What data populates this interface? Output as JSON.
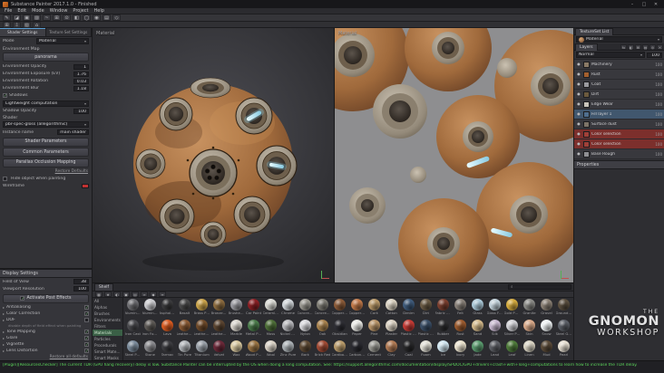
{
  "window": {
    "title": "Substance Painter 2017.1.0 - Finished",
    "controls": [
      {
        "name": "minimize-button",
        "glyph": "–"
      },
      {
        "name": "maximize-button",
        "glyph": "□"
      },
      {
        "name": "close-button",
        "glyph": "✕"
      }
    ]
  },
  "menu": {
    "items": [
      {
        "label": "File"
      },
      {
        "label": "Edit"
      },
      {
        "label": "Mode"
      },
      {
        "label": "Window"
      },
      {
        "label": "Project"
      },
      {
        "label": "Help"
      }
    ]
  },
  "toolbar": {
    "row1": [
      {
        "name": "paint-tool-icon",
        "glyph": "✎"
      },
      {
        "name": "eraser-tool-icon",
        "glyph": "◪"
      },
      {
        "name": "projection-tool-icon",
        "glyph": "▣"
      },
      {
        "name": "polygon-fill-tool-icon",
        "glyph": "▨"
      },
      {
        "name": "smudge-tool-icon",
        "glyph": "~"
      },
      {
        "name": "clone-tool-icon",
        "glyph": "⊞"
      },
      {
        "name": "material-picker-tool-icon",
        "glyph": "⊙"
      },
      {
        "name": "quick-mask-icon",
        "glyph": "◧"
      },
      {
        "name": "brush-size-icon",
        "glyph": "◯"
      },
      {
        "name": "brush-flow-icon",
        "glyph": "◉"
      },
      {
        "name": "stencil-icon",
        "glyph": "▤"
      },
      {
        "name": "symmetry-icon",
        "glyph": "◇"
      }
    ],
    "row2": [
      {
        "name": "add-layer-icon",
        "glyph": "⊞"
      },
      {
        "name": "import-resource-icon",
        "glyph": "⇩"
      },
      {
        "name": "bake-textures-icon",
        "glyph": "▧"
      },
      {
        "name": "camera-icon",
        "glyph": "⌂"
      }
    ]
  },
  "viewports": {
    "left_label": "Material",
    "right_label": "Material"
  },
  "left": {
    "tabs": [
      {
        "label": "Shader Settings",
        "state": "on"
      },
      {
        "label": "Texture Set Settings"
      }
    ],
    "mode_label": "Mode",
    "mode_value": "Material",
    "env_map_label": "Environment Map",
    "env_map_value": "panorama",
    "params": [
      {
        "label": "Environment Opacity",
        "value": "1"
      },
      {
        "label": "Environment Exposure (EV)",
        "value": "1.76"
      },
      {
        "label": "Environment Rotation",
        "value": "0.03"
      },
      {
        "label": "Environment Blur",
        "value": "1.18"
      }
    ],
    "shadows_check": "✓",
    "shadows_label": "Shadows",
    "shadows_value": "Lightweight computation",
    "shadow_opacity_label": "Shadow Opacity",
    "shadow_opacity_value": "100",
    "shader_label": "Shader",
    "shader_value": "pbr-spec-gloss (allegorithmic)",
    "instance_label": "Instance name",
    "instance_value": "main shader",
    "buttons": [
      "Shader Parameters",
      "Common Parameters",
      "Parallax Occlusion Mapping"
    ],
    "restore_label": "Restore Defaults",
    "hide_check": "",
    "hide_label": "Hide object when painting",
    "wireframe_label": "Wireframe"
  },
  "display": {
    "title": "Display Settings",
    "params": [
      {
        "label": "Field of View",
        "value": "38"
      },
      {
        "label": "Viewport Resolution",
        "value": "100"
      }
    ],
    "activate_check": "✓",
    "activate_label": "Activate Post Effects",
    "effects": [
      {
        "label": "Antialiasing",
        "state": "checked"
      },
      {
        "label": "Color Correction",
        "state": "checked"
      },
      {
        "label": "DOF",
        "note": "disable depth of field effect when painting"
      },
      {
        "label": "Tone Mapping",
        "state": "checked"
      },
      {
        "label": "Glare",
        "state": "checked"
      },
      {
        "label": "Vignette",
        "state": "checked"
      },
      {
        "label": "Lens Distortion",
        "state": "checked"
      }
    ],
    "restore_label": "Restore all defaults"
  },
  "right": {
    "textureset_tab": "TextureSet List",
    "textureset_value": "Material",
    "layers_tab": "Layers",
    "layer_icons": [
      {
        "name": "add-effect-icon",
        "glyph": "fx"
      },
      {
        "name": "add-fill-layer-icon",
        "glyph": "◧"
      },
      {
        "name": "add-layer-icon",
        "glyph": "⊞"
      },
      {
        "name": "add-folder-icon",
        "glyph": "▤"
      },
      {
        "name": "add-mask-icon",
        "glyph": "◎"
      },
      {
        "name": "delete-layer-icon",
        "glyph": "✕"
      }
    ],
    "blend_value": "Normal",
    "opacity_value": "100",
    "layers": [
      {
        "name": "Machinery",
        "opacity": "100",
        "thumb": "#8a7a66"
      },
      {
        "name": "Rust",
        "opacity": "100",
        "thumb": "#a35f2e"
      },
      {
        "name": "Coat",
        "opacity": "100",
        "thumb": "#9a9a9e"
      },
      {
        "name": "Dirt",
        "opacity": "100",
        "thumb": "#6b5a3e"
      },
      {
        "name": "Edge Wear",
        "opacity": "100",
        "thumb": "#c8c4ba"
      },
      {
        "name": "Fill layer 1",
        "opacity": "100",
        "thumb": "#4f6e8e",
        "state": "blue"
      },
      {
        "name": "Surface dust",
        "opacity": "100",
        "thumb": "#7d7468"
      },
      {
        "name": "Color selection",
        "opacity": "100",
        "thumb": "#a04038",
        "state": "red"
      },
      {
        "name": "Color selection",
        "opacity": "100",
        "thumb": "#a04038",
        "state": "red"
      },
      {
        "name": "Base Rough",
        "opacity": "100",
        "thumb": "#8f8f93"
      }
    ],
    "properties_title": "Properties"
  },
  "shelf": {
    "tab": "Shelf",
    "filters": [
      {
        "name": "filter-all-icon",
        "glyph": "▦"
      },
      {
        "name": "filter-favorites-icon",
        "glyph": "★"
      },
      {
        "name": "filter-recent-icon",
        "glyph": "◐"
      },
      {
        "name": "filter-project-icon",
        "glyph": "▣"
      },
      {
        "name": "filter-shelf-icon",
        "glyph": "▤"
      },
      {
        "name": "filter-link-icon",
        "glyph": "∞"
      },
      {
        "name": "filter-tag-icon",
        "glyph": "◆"
      },
      {
        "name": "filter-list-icon",
        "glyph": "≡"
      }
    ],
    "categories": [
      {
        "label": "All"
      },
      {
        "label": "Alphas"
      },
      {
        "label": "Brushes"
      },
      {
        "label": "Environments"
      },
      {
        "label": "Filters"
      },
      {
        "label": "Materials",
        "state": "on"
      },
      {
        "label": "Particles"
      },
      {
        "label": "Procedurals"
      },
      {
        "label": "Smart Materials"
      },
      {
        "label": "Smart Masks"
      },
      {
        "label": "Textures"
      }
    ],
    "materials": [
      {
        "name": "Aluminium Anodized",
        "color": "#6e6e72"
      },
      {
        "name": "Aluminium Pure",
        "color": "#c9c9cd"
      },
      {
        "name": "Asphalt Fresh",
        "color": "#3a3a3c"
      },
      {
        "name": "Basalt",
        "color": "#4a4a4a"
      },
      {
        "name": "Brass Pure",
        "color": "#c9a24a"
      },
      {
        "name": "Bronze Base",
        "color": "#8a6a3e"
      },
      {
        "name": "Brushed Metal",
        "color": "#9a9aa0"
      },
      {
        "name": "Car Paint",
        "color": "#8a1f24"
      },
      {
        "name": "Ceramic Gloss",
        "color": "#d8d8d2"
      },
      {
        "name": "Chrome",
        "color": "#cfd4d8"
      },
      {
        "name": "Concrete Clean",
        "color": "#9a9890"
      },
      {
        "name": "Concrete Dirty",
        "color": "#7e7c74"
      },
      {
        "name": "Copper Old",
        "color": "#8a5a38"
      },
      {
        "name": "Copper Pure",
        "color": "#c07848"
      },
      {
        "name": "Cork",
        "color": "#b89868"
      },
      {
        "name": "Cotton",
        "color": "#d8d0c0"
      },
      {
        "name": "Denim",
        "color": "#3e5a7a"
      },
      {
        "name": "Dirt",
        "color": "#6a5a44"
      },
      {
        "name": "Fabric Rough",
        "color": "#7a3e2e"
      },
      {
        "name": "Felt",
        "color": "#888078"
      },
      {
        "name": "Glass",
        "color": "#aac8d8"
      },
      {
        "name": "Glass Frosted",
        "color": "#c2d2da"
      },
      {
        "name": "Gold Pure",
        "color": "#d4aa3e"
      },
      {
        "name": "Granite",
        "color": "#8a8a86"
      },
      {
        "name": "Gravel",
        "color": "#8a8074"
      },
      {
        "name": "Ground Wet",
        "color": "#5a4e3e"
      },
      {
        "name": "Iron Cast",
        "color": "#4a4a4e"
      },
      {
        "name": "Iron Forged",
        "color": "#5e5a56"
      },
      {
        "name": "Lava",
        "color": "#d85a20"
      },
      {
        "name": "Leather Fine",
        "color": "#8a5a34"
      },
      {
        "name": "Leather Rough",
        "color": "#6e4a2a"
      },
      {
        "name": "Leather Worn",
        "color": "#5a4430"
      },
      {
        "name": "Marble",
        "color": "#d8d4cc"
      },
      {
        "name": "Metal Painted",
        "color": "#4a7a4a"
      },
      {
        "name": "Moss",
        "color": "#4e6e38"
      },
      {
        "name": "Nickel Pure",
        "color": "#b8b8bc"
      },
      {
        "name": "Nylon",
        "color": "#d8d8dc"
      },
      {
        "name": "Oak",
        "color": "#a8824e"
      },
      {
        "name": "Obsidian",
        "color": "#2e2e34"
      },
      {
        "name": "Paper",
        "color": "#e8e8e4"
      },
      {
        "name": "Pine",
        "color": "#b89468"
      },
      {
        "name": "Plaster",
        "color": "#d8cfc0"
      },
      {
        "name": "Plastic Glossy",
        "color": "#c23a34"
      },
      {
        "name": "Plastic Rough",
        "color": "#3a4e66"
      },
      {
        "name": "Rubber",
        "color": "#2e2e30"
      },
      {
        "name": "Rust",
        "color": "#9a5a2e"
      },
      {
        "name": "Sand",
        "color": "#d2b88a"
      },
      {
        "name": "Silk",
        "color": "#c8b8d0"
      },
      {
        "name": "Silver Pure",
        "color": "#d0d0d4"
      },
      {
        "name": "Skin",
        "color": "#d8a888"
      },
      {
        "name": "Snow",
        "color": "#eef2f4"
      },
      {
        "name": "Steel Gun",
        "color": "#5a5e66"
      },
      {
        "name": "Steel Painted",
        "color": "#7a8a9a"
      },
      {
        "name": "Stone",
        "color": "#8a8a8e"
      },
      {
        "name": "Tarmac",
        "color": "#3c3c40"
      },
      {
        "name": "Tin Pure",
        "color": "#b0b4b8"
      },
      {
        "name": "Titanium",
        "color": "#9aa0a8"
      },
      {
        "name": "Velvet",
        "color": "#6a2838"
      },
      {
        "name": "Wax",
        "color": "#d8c8a0"
      },
      {
        "name": "Wood Planks",
        "color": "#9a7444"
      },
      {
        "name": "Wool",
        "color": "#d8d0c4"
      },
      {
        "name": "Zinc Pure",
        "color": "#aab0b4"
      },
      {
        "name": "Bark",
        "color": "#5e4a34"
      },
      {
        "name": "Brick Red",
        "color": "#a04a34"
      },
      {
        "name": "Cardboard",
        "color": "#b89a6a"
      },
      {
        "name": "Carbon Fiber",
        "color": "#2a2a30"
      },
      {
        "name": "Cement",
        "color": "#9a9a94"
      },
      {
        "name": "Clay",
        "color": "#b07a54"
      },
      {
        "name": "Coal",
        "color": "#28282a"
      },
      {
        "name": "Foam",
        "color": "#e0ded4"
      },
      {
        "name": "Ice",
        "color": "#cfe4ee"
      },
      {
        "name": "Ivory",
        "color": "#e8e0cc"
      },
      {
        "name": "Jade",
        "color": "#5a9a6e"
      },
      {
        "name": "Lead",
        "color": "#5e6066"
      },
      {
        "name": "Leaf",
        "color": "#4e7a3a"
      },
      {
        "name": "Linen",
        "color": "#d8d2c2"
      },
      {
        "name": "Mud",
        "color": "#5a4a38"
      },
      {
        "name": "Pearl",
        "color": "#e4ddd0"
      }
    ]
  },
  "watermark": {
    "line1": "THE",
    "line2": "GNOMON",
    "line3": "WORKSHOP"
  },
  "status": {
    "message": "[Plugin][ResourcesChecker] The current TDR (GPU hang recovery) delay is low. Substance Painter can be interrupted by the OS when doing a long computation. See: https://support.allegorithmic.com/documentation/display/SPDOC/GPU+drivers+crash+with+long+computations to learn how to increase the TDR delay."
  },
  "colors": {
    "accent": "#5a9fd4",
    "selection_red": "#7c2f2c",
    "selection_blue": "#41576e",
    "status_green": "#5cd65c",
    "wireframe_red": "#c23232",
    "shelf_selected_green": "#3a5f46"
  }
}
